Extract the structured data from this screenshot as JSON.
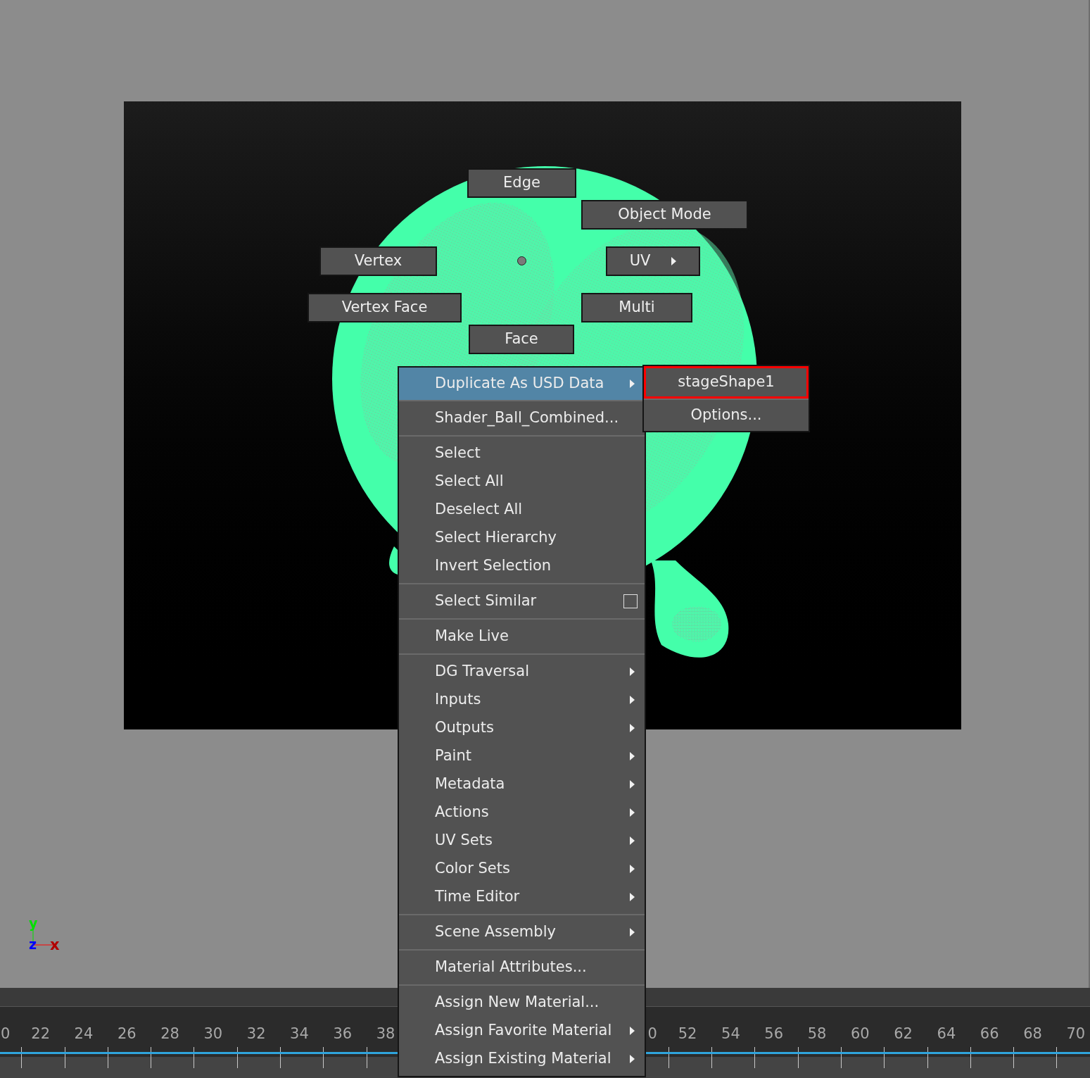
{
  "marking_menu": [
    {
      "label": "Edge",
      "submenu": false
    },
    {
      "label": "Object Mode",
      "submenu": false
    },
    {
      "label": "Vertex",
      "submenu": false
    },
    {
      "label": "UV",
      "submenu": true
    },
    {
      "label": "Vertex Face",
      "submenu": false
    },
    {
      "label": "Multi",
      "submenu": false
    },
    {
      "label": "Face",
      "submenu": false
    }
  ],
  "context_menu": {
    "sections": [
      [
        {
          "label": "Duplicate As USD Data",
          "submenu": true,
          "selected": true
        }
      ],
      [
        {
          "label": "Shader_Ball_Combined...",
          "submenu": false,
          "selected": false
        }
      ],
      [
        {
          "label": "Select",
          "submenu": false,
          "selected": false
        },
        {
          "label": "Select All",
          "submenu": false,
          "selected": false
        },
        {
          "label": "Deselect All",
          "submenu": false,
          "selected": false
        },
        {
          "label": "Select Hierarchy",
          "submenu": false,
          "selected": false
        },
        {
          "label": "Invert Selection",
          "submenu": false,
          "selected": false
        }
      ],
      [
        {
          "label": "Select Similar",
          "submenu": false,
          "selected": false,
          "option_box": true
        }
      ],
      [
        {
          "label": "Make Live",
          "submenu": false,
          "selected": false
        }
      ],
      [
        {
          "label": "DG Traversal",
          "submenu": true,
          "selected": false
        },
        {
          "label": "Inputs",
          "submenu": true,
          "selected": false
        },
        {
          "label": "Outputs",
          "submenu": true,
          "selected": false
        },
        {
          "label": "Paint",
          "submenu": true,
          "selected": false
        },
        {
          "label": "Metadata",
          "submenu": true,
          "selected": false
        },
        {
          "label": "Actions",
          "submenu": true,
          "selected": false
        },
        {
          "label": "UV Sets",
          "submenu": true,
          "selected": false
        },
        {
          "label": "Color Sets",
          "submenu": true,
          "selected": false
        },
        {
          "label": "Time Editor",
          "submenu": true,
          "selected": false
        }
      ],
      [
        {
          "label": "Scene Assembly",
          "submenu": true,
          "selected": false
        }
      ],
      [
        {
          "label": "Material Attributes...",
          "submenu": false,
          "selected": false
        }
      ],
      [
        {
          "label": "Assign New Material...",
          "submenu": false,
          "selected": false
        },
        {
          "label": "Assign Favorite Material",
          "submenu": true,
          "selected": false
        },
        {
          "label": "Assign Existing Material",
          "submenu": true,
          "selected": false
        }
      ]
    ]
  },
  "submenu": [
    {
      "label": "stageShape1",
      "highlighted": true
    },
    {
      "label": "Options...",
      "highlighted": false
    }
  ],
  "axis": {
    "y": "y",
    "z": "z",
    "x": "x"
  },
  "timeline": {
    "left_labels": [
      {
        "label": "0",
        "kind": "partial"
      },
      {
        "label": "22",
        "kind": "full"
      },
      {
        "label": "24",
        "kind": "full"
      },
      {
        "label": "26",
        "kind": "full"
      },
      {
        "label": "28",
        "kind": "full"
      },
      {
        "label": "30",
        "kind": "full"
      },
      {
        "label": "32",
        "kind": "full"
      },
      {
        "label": "34",
        "kind": "full"
      },
      {
        "label": "36",
        "kind": "full"
      },
      {
        "label": "38",
        "kind": "full"
      }
    ],
    "right_labels": [
      {
        "label": "0",
        "kind": "partial"
      },
      {
        "label": "52",
        "kind": "full"
      },
      {
        "label": "54",
        "kind": "full"
      },
      {
        "label": "56",
        "kind": "full"
      },
      {
        "label": "58",
        "kind": "full"
      },
      {
        "label": "60",
        "kind": "full"
      },
      {
        "label": "62",
        "kind": "full"
      },
      {
        "label": "64",
        "kind": "full"
      },
      {
        "label": "66",
        "kind": "full"
      },
      {
        "label": "68",
        "kind": "full"
      },
      {
        "label": "70",
        "kind": "full"
      }
    ]
  }
}
